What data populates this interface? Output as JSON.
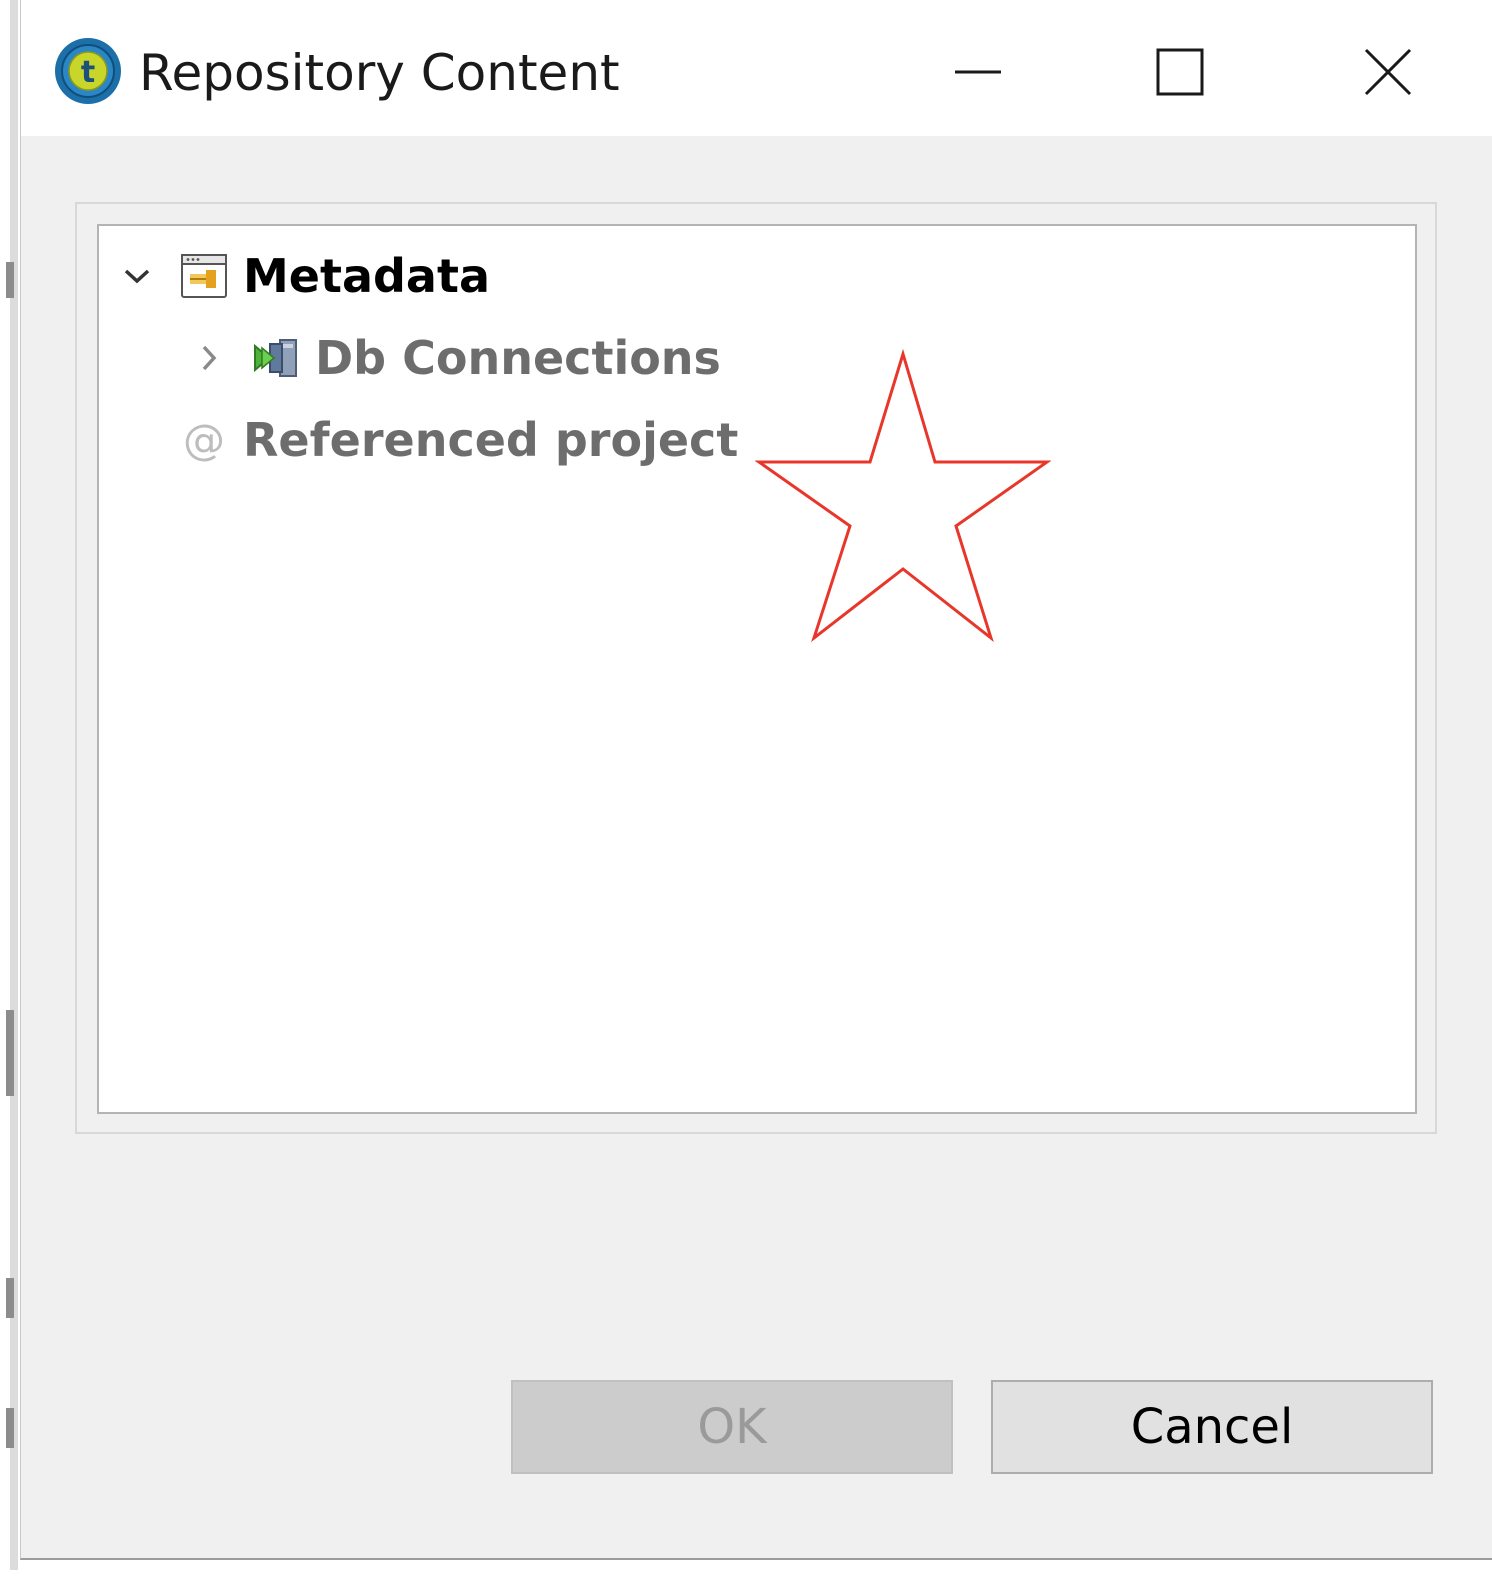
{
  "window": {
    "title": "Repository Content",
    "app_icon": "talend-logo-icon",
    "controls": {
      "minimize": "minimize-icon",
      "maximize": "maximize-icon",
      "close": "close-icon"
    }
  },
  "tree": {
    "items": [
      {
        "label": "Metadata",
        "icon": "metadata-folder-icon",
        "expanded": true,
        "enabled": true
      },
      {
        "label": "Db Connections",
        "icon": "db-connections-icon",
        "expanded": false,
        "enabled": false
      },
      {
        "label": "Referenced project",
        "icon": "at-sign-icon",
        "enabled": false
      }
    ]
  },
  "annotation": {
    "shape": "star-outline",
    "color": "#e8372a"
  },
  "buttons": {
    "ok": {
      "label": "OK",
      "enabled": false
    },
    "cancel": {
      "label": "Cancel",
      "enabled": true
    }
  },
  "colors": {
    "dialog_background": "#f0f0f0",
    "titlebar_background": "#ffffff",
    "disabled_text": "#6d6d6d",
    "app_icon_blue": "#1c6fa8",
    "app_icon_yellow": "#c8d62b"
  }
}
